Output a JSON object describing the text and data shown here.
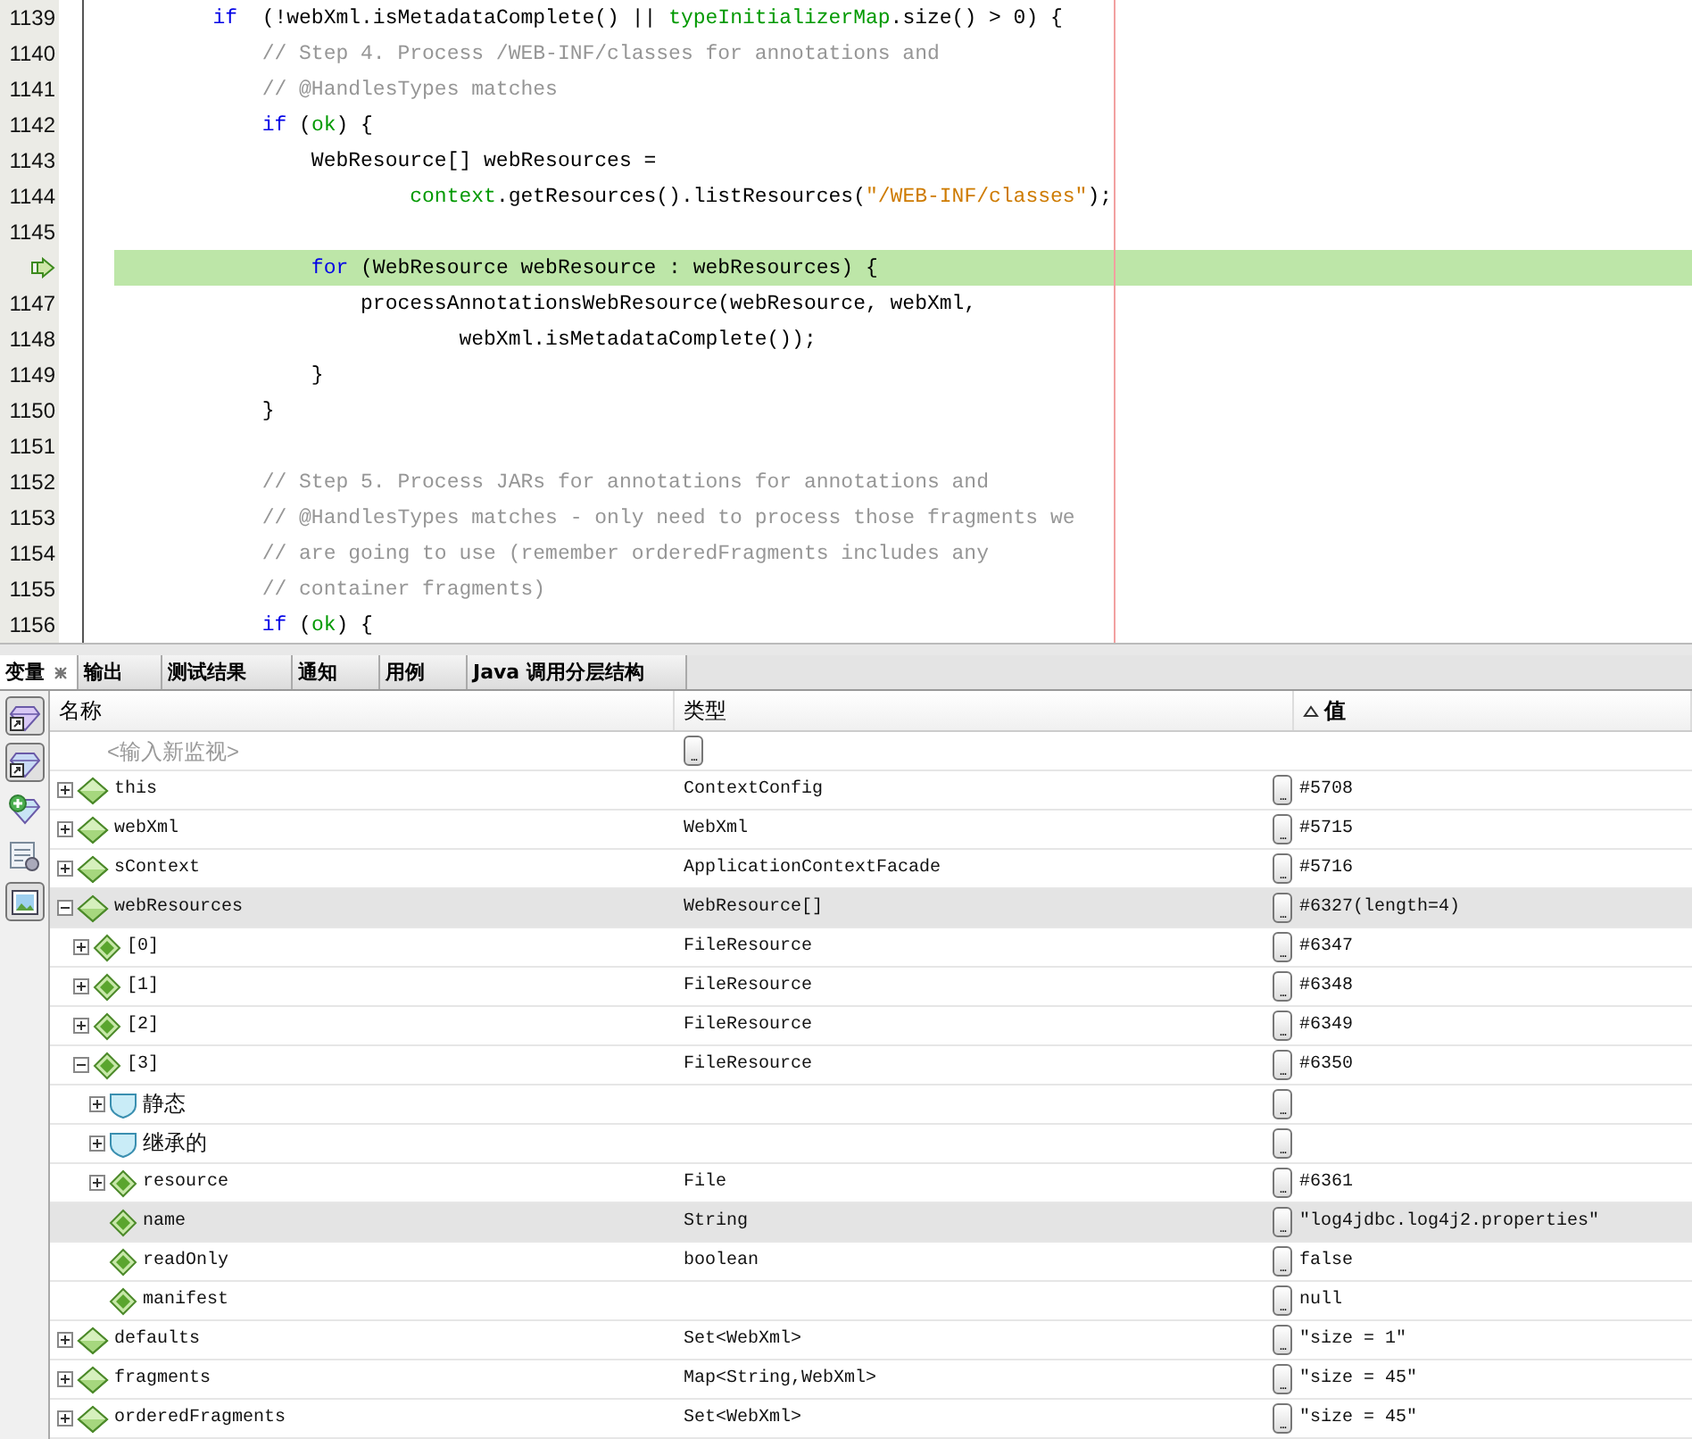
{
  "editor": {
    "lines": [
      {
        "number": "1139",
        "current": false,
        "tokens": [
          {
            "kind": "keyword",
            "text": "        if"
          },
          {
            "kind": "plain",
            "text": "  (!webXml.isMetadataComplete() || "
          },
          {
            "kind": "field",
            "text": "typeInitializerMap"
          },
          {
            "kind": "plain",
            "text": ".size() > 0) {"
          }
        ]
      },
      {
        "number": "1140",
        "current": false,
        "tokens": [
          {
            "kind": "comment",
            "text": "            // Step 4. Process /WEB-INF/classes for annotations and"
          }
        ]
      },
      {
        "number": "1141",
        "current": false,
        "tokens": [
          {
            "kind": "comment",
            "text": "            // @HandlesTypes matches"
          }
        ]
      },
      {
        "number": "1142",
        "current": false,
        "tokens": [
          {
            "kind": "keyword",
            "text": "            if"
          },
          {
            "kind": "plain",
            "text": " ("
          },
          {
            "kind": "field",
            "text": "ok"
          },
          {
            "kind": "plain",
            "text": ") {"
          }
        ]
      },
      {
        "number": "1143",
        "current": false,
        "tokens": [
          {
            "kind": "plain",
            "text": "                WebResource[] webResources ="
          }
        ]
      },
      {
        "number": "1144",
        "current": false,
        "tokens": [
          {
            "kind": "field",
            "text": "                        context"
          },
          {
            "kind": "plain",
            "text": ".getResources().listResources("
          },
          {
            "kind": "string",
            "text": "\"/WEB-INF/classes\""
          },
          {
            "kind": "plain",
            "text": ");"
          }
        ]
      },
      {
        "number": "1145",
        "current": false
      },
      {
        "current": true,
        "tokens": [
          {
            "kind": "keyword",
            "text": "                for"
          },
          {
            "kind": "plain",
            "text": " (WebResource webResource : webResources) {"
          }
        ]
      },
      {
        "number": "1147",
        "current": false,
        "tokens": [
          {
            "kind": "plain",
            "text": "                    processAnnotationsWebResource(webResource, webXml,"
          }
        ]
      },
      {
        "number": "1148",
        "current": false,
        "tokens": [
          {
            "kind": "plain",
            "text": "                            webXml.isMetadataComplete());"
          }
        ]
      },
      {
        "number": "1149",
        "current": false,
        "tokens": [
          {
            "kind": "plain",
            "text": "                }"
          }
        ]
      },
      {
        "number": "1150",
        "current": false,
        "tokens": [
          {
            "kind": "plain",
            "text": "            }"
          }
        ]
      },
      {
        "number": "1151",
        "current": false
      },
      {
        "number": "1152",
        "current": false,
        "tokens": [
          {
            "kind": "comment",
            "text": "            // Step 5. Process JARs for annotations for annotations and"
          }
        ]
      },
      {
        "number": "1153",
        "current": false,
        "tokens": [
          {
            "kind": "comment",
            "text": "            // @HandlesTypes matches - only need to process those fragments we"
          }
        ]
      },
      {
        "number": "1154",
        "current": false,
        "tokens": [
          {
            "kind": "comment",
            "text": "            // are going to use (remember orderedFragments includes any"
          }
        ]
      },
      {
        "number": "1155",
        "current": false,
        "tokens": [
          {
            "kind": "comment",
            "text": "            // container fragments)"
          }
        ]
      },
      {
        "number": "1156",
        "current": false,
        "tokens": [
          {
            "kind": "keyword",
            "text": "            if"
          },
          {
            "kind": "plain",
            "text": " ("
          },
          {
            "kind": "field",
            "text": "ok"
          },
          {
            "kind": "plain",
            "text": ") {"
          }
        ]
      }
    ]
  },
  "panel": {
    "tabs": [
      {
        "label": "变量",
        "selected": true,
        "closable": true
      },
      {
        "label": "输出",
        "selected": false,
        "closable": false
      },
      {
        "label": "测试结果",
        "selected": false,
        "closable": false
      },
      {
        "label": "通知",
        "selected": false,
        "closable": false
      },
      {
        "label": "用例",
        "selected": false,
        "closable": false
      },
      {
        "label": "Java 调用分层结构",
        "selected": false,
        "closable": false
      }
    ],
    "table": {
      "columns": [
        {
          "label": "名称",
          "sorted": false
        },
        {
          "label": "类型",
          "sorted": false
        },
        {
          "label": "值",
          "sorted": true
        }
      ],
      "watch": {
        "placeholder": "<输入新监视>",
        "edit_button": "..."
      },
      "rows": [
        {
          "name": "this",
          "kind": "field",
          "type": "ContextConfig",
          "value": "#5708",
          "edit_button": "...",
          "expandable": true,
          "expanded": false,
          "selected": false
        },
        {
          "name": "webXml",
          "kind": "field",
          "type": "WebXml",
          "value": "#5715",
          "edit_button": "...",
          "expandable": true,
          "expanded": false,
          "selected": false
        },
        {
          "name": "sContext",
          "kind": "field",
          "type": "ApplicationContextFacade",
          "value": "#5716",
          "edit_button": "...",
          "expandable": true,
          "expanded": false,
          "selected": false
        },
        {
          "name": "webResources",
          "kind": "field",
          "type": "WebResource[]",
          "value": "#6327(length=4)",
          "edit_button": "...",
          "expandable": true,
          "expanded": true,
          "selected": true,
          "children": [
            {
              "name": "[0]",
              "kind": "field",
              "type": "FileResource",
              "value": "#6347",
              "edit_button": "...",
              "expandable": true,
              "expanded": false,
              "selected": false
            },
            {
              "name": "[1]",
              "kind": "field",
              "type": "FileResource",
              "value": "#6348",
              "edit_button": "...",
              "expandable": true,
              "expanded": false,
              "selected": false
            },
            {
              "name": "[2]",
              "kind": "field",
              "type": "FileResource",
              "value": "#6349",
              "edit_button": "...",
              "expandable": true,
              "expanded": false,
              "selected": false
            },
            {
              "name": "[3]",
              "kind": "field",
              "type": "FileResource",
              "value": "#6350",
              "edit_button": "...",
              "expandable": true,
              "expanded": true,
              "selected": false,
              "children": [
                {
                  "name": "静态",
                  "kind": "group",
                  "edit_button": "...",
                  "expandable": true,
                  "expanded": false,
                  "selected": false
                },
                {
                  "name": "继承的",
                  "kind": "group",
                  "edit_button": "...",
                  "expandable": true,
                  "expanded": false,
                  "selected": false
                },
                {
                  "name": "resource",
                  "kind": "field",
                  "type": "File",
                  "value": "#6361",
                  "edit_button": "...",
                  "expandable": true,
                  "expanded": false,
                  "selected": false
                },
                {
                  "name": "name",
                  "kind": "field",
                  "type": "String",
                  "value": "\"log4jdbc.log4j2.properties\"",
                  "edit_button": "...",
                  "expandable": false,
                  "selected": true
                },
                {
                  "name": "readOnly",
                  "kind": "field",
                  "type": "boolean",
                  "value": "false",
                  "edit_button": "...",
                  "expandable": false,
                  "selected": false
                },
                {
                  "name": "manifest",
                  "kind": "field",
                  "value": "null",
                  "edit_button": "...",
                  "expandable": false,
                  "selected": false
                }
              ]
            }
          ]
        },
        {
          "name": "defaults",
          "kind": "field",
          "type": "Set<WebXml>",
          "value": "\"size = 1\"",
          "edit_button": "...",
          "expandable": true,
          "expanded": false,
          "selected": false
        },
        {
          "name": "fragments",
          "kind": "field",
          "type": "Map<String,WebXml>",
          "value": "\"size = 45\"",
          "edit_button": "...",
          "expandable": true,
          "expanded": false,
          "selected": false
        },
        {
          "name": "orderedFragments",
          "kind": "field",
          "type": "Set<WebXml>",
          "value": "\"size = 45\"",
          "edit_button": "...",
          "expandable": true,
          "expanded": false,
          "selected": false
        }
      ]
    }
  }
}
